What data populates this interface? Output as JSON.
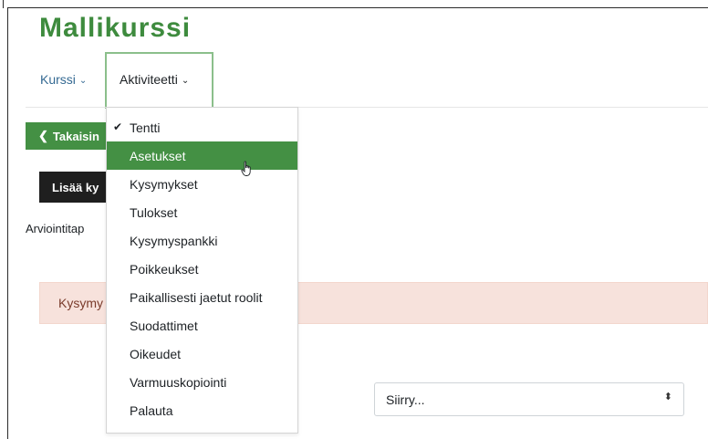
{
  "course": {
    "title": "Mallikurssi"
  },
  "nav": {
    "kurssi_label": "Kurssi",
    "aktiviteetti_label": "Aktiviteetti"
  },
  "buttons": {
    "back_label": "Takaisin",
    "add_label": "Lisää ky"
  },
  "grading_text": "Arviointitap",
  "alert_text": "Kysymy",
  "jump_select": {
    "selected": "Siirry..."
  },
  "menu": {
    "items": [
      {
        "label": "Tentti",
        "checked": true
      },
      {
        "label": "Asetukset",
        "highlighted": true
      },
      {
        "label": "Kysymykset"
      },
      {
        "label": "Tulokset"
      },
      {
        "label": "Kysymyspankki"
      },
      {
        "label": "Poikkeukset"
      },
      {
        "label": "Paikallisesti jaetut roolit"
      },
      {
        "label": "Suodattimet"
      },
      {
        "label": "Oikeudet"
      },
      {
        "label": "Varmuuskopiointi"
      },
      {
        "label": "Palauta"
      }
    ]
  },
  "colors": {
    "brand_green": "#3e8b3e",
    "button_green": "#449044",
    "alert_bg": "#f7e2dc",
    "link_blue": "#356a93"
  },
  "icons": {
    "chevron": "chevron-down-icon",
    "back": "chevron-left-icon",
    "check": "check-icon",
    "select_arrows": "sort-arrows-icon",
    "cursor": "hand-pointer-icon"
  }
}
